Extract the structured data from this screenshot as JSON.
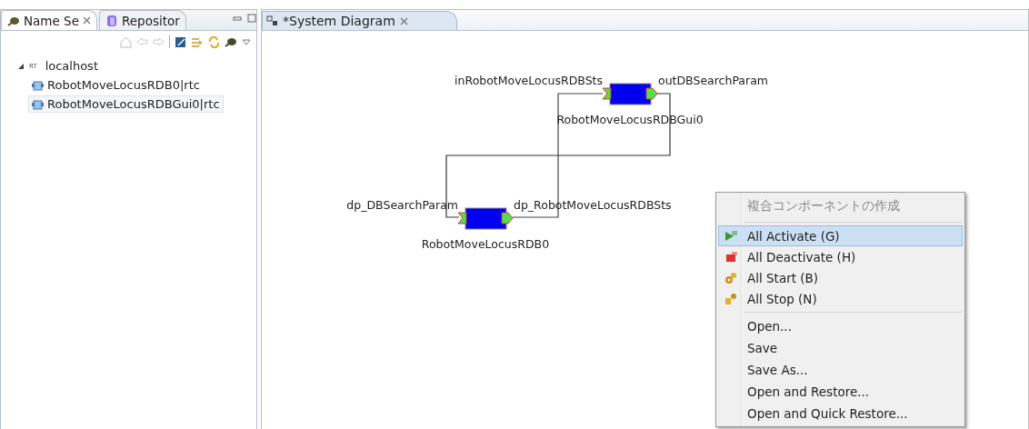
{
  "left_panel": {
    "tabs": [
      {
        "label": "Name Se",
        "selected": true,
        "closable": true
      },
      {
        "label": "Repositor",
        "selected": false,
        "closable": false
      }
    ],
    "tree": [
      {
        "label": "localhost",
        "badge": "RT",
        "expanded": true,
        "selected": false,
        "children": [
          {
            "label": "RobotMoveLocusRDB0|rtc",
            "selected": false
          },
          {
            "label": "RobotMoveLocusRDBGui0|rtc",
            "selected": true
          }
        ]
      }
    ]
  },
  "editor": {
    "tabs": [
      {
        "label": "*System Diagram",
        "selected": true
      }
    ],
    "diagram": {
      "components": [
        {
          "name": "RobotMoveLocusRDBGui0",
          "in_port": "inRobotMoveLocusRDBSts",
          "out_port": "outDBSearchParam"
        },
        {
          "name": "RobotMoveLocusRDB0",
          "in_port": "dp_DBSearchParam",
          "out_port": "dp_RobotMoveLocusRDBSts"
        }
      ]
    }
  },
  "context_menu": {
    "groups": [
      [
        {
          "label": "複合コンポーネントの作成",
          "disabled": true,
          "selected": false
        }
      ],
      [
        {
          "label": "All Activate (G)",
          "disabled": false,
          "selected": true
        },
        {
          "label": "All Deactivate (H)",
          "disabled": false,
          "selected": false
        },
        {
          "label": "All Start (B)",
          "disabled": false,
          "selected": false
        },
        {
          "label": "All Stop (N)",
          "disabled": false,
          "selected": false
        }
      ],
      [
        {
          "label": "Open...",
          "disabled": false,
          "selected": false
        },
        {
          "label": "Save",
          "disabled": false,
          "selected": false
        },
        {
          "label": "Save As...",
          "disabled": false,
          "selected": false
        },
        {
          "label": "Open and Restore...",
          "disabled": false,
          "selected": false
        },
        {
          "label": "Open and Quick Restore...",
          "disabled": false,
          "selected": false
        }
      ]
    ]
  }
}
